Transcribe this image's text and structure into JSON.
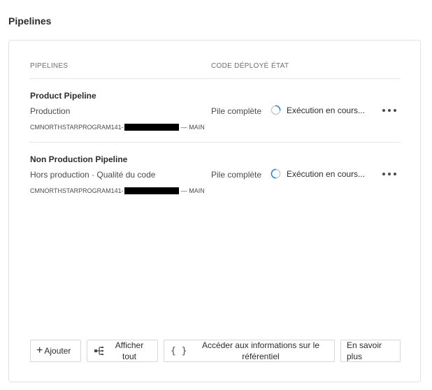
{
  "section": {
    "title": "Pipelines"
  },
  "table": {
    "headers": {
      "pipelines": "PIPELINES",
      "code": "CODE DÉPLOYÉ",
      "state": "ÉTAT"
    }
  },
  "pipelines": [
    {
      "name": "Product Pipeline",
      "type": "Production",
      "repo_prefix": "CMNORTHSTARPROGRAM141-",
      "repo_suffix": "— MAIN",
      "deploy": "Pile complète",
      "status": "Exécution en cours..."
    },
    {
      "name": "Non Production Pipeline",
      "type": "Hors production · Qualité du code",
      "repo_prefix": "CMNORTHSTARPROGRAM141-",
      "repo_suffix": "— MAIN",
      "deploy": "Pile complète",
      "status": "Exécution en cours..."
    }
  ],
  "actions": {
    "add": "Ajouter",
    "show_all": "Afficher tout",
    "repo_info": "Accéder aux informations sur le référentiel",
    "learn_more": "En savoir plus"
  },
  "icons": {
    "add": "plus-icon",
    "show_all": "hierarchy-icon",
    "repo_info": "code-braces-icon",
    "status": "spinner-icon",
    "more": "more-icon"
  },
  "colors": {
    "spinner": "#2680eb",
    "spinner_track": "#cccccc"
  }
}
